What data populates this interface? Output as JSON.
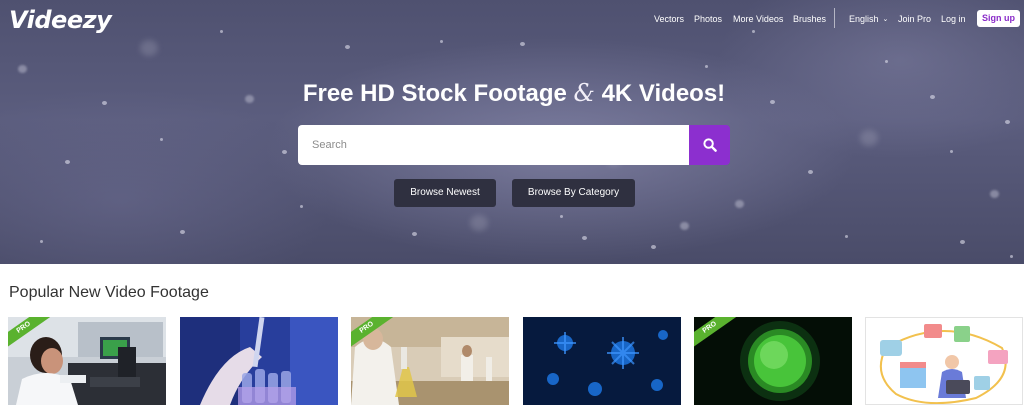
{
  "brand": {
    "logo_text": "Videezy",
    "accent": "#8c2fcf",
    "pro_badge_color": "#5ab22f"
  },
  "nav": {
    "links": [
      "Vectors",
      "Photos",
      "More Videos",
      "Brushes"
    ],
    "language": "English",
    "join_pro": "Join Pro",
    "login": "Log in",
    "signup": "Sign up"
  },
  "hero": {
    "headline_part1": "Free HD Stock Footage ",
    "headline_amp": "&",
    "headline_part2": " 4K Videos!",
    "search": {
      "placeholder": "Search",
      "value": "",
      "button_icon": "search-icon"
    },
    "buttons": {
      "browse_newest": "Browse Newest",
      "browse_category": "Browse By Category"
    }
  },
  "popular": {
    "title": "Popular New Video Footage",
    "videos": [
      {
        "subject": "scientist-microscope",
        "pro": true,
        "pro_label": "PRO"
      },
      {
        "subject": "pipette-test-tubes",
        "pro": false
      },
      {
        "subject": "laboratory-workers",
        "pro": true,
        "pro_label": "PRO"
      },
      {
        "subject": "blue-virus-particles",
        "pro": false
      },
      {
        "subject": "green-virus-cell",
        "pro": true,
        "pro_label": "PRO"
      },
      {
        "subject": "online-shopping-illustration",
        "pro": false
      }
    ]
  }
}
